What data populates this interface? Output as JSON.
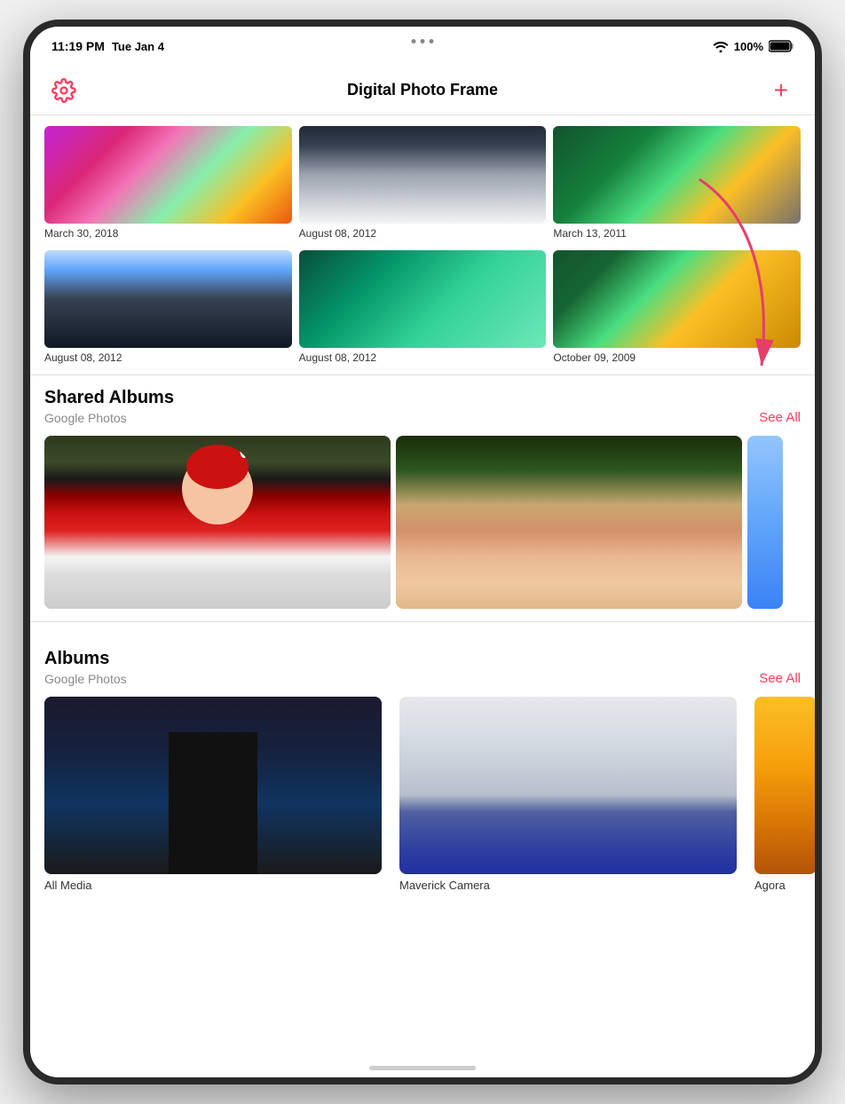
{
  "statusBar": {
    "time": "11:19 PM",
    "date": "Tue Jan 4",
    "battery": "100%",
    "wifi": true
  },
  "header": {
    "title": "Digital Photo Frame",
    "addButton": "+",
    "gearButton": "⚙"
  },
  "photoGrid": {
    "row1": [
      {
        "date": "March 30, 2018",
        "colorClass": "pg1"
      },
      {
        "date": "August 08, 2012",
        "colorClass": "pg2"
      },
      {
        "date": "March 13, 2011",
        "colorClass": "pg3"
      }
    ],
    "row2": [
      {
        "date": "August 08, 2012",
        "colorClass": "pg4"
      },
      {
        "date": "August 08, 2012",
        "colorClass": "pg5"
      },
      {
        "date": "October 09, 2009",
        "colorClass": "pg6"
      }
    ]
  },
  "sharedAlbums": {
    "title": "Shared Albums",
    "subtitle": "Google Photos",
    "seeAll": "See All"
  },
  "albums": {
    "title": "Albums",
    "subtitle": "Google Photos",
    "seeAll": "See All",
    "items": [
      {
        "label": "All Media"
      },
      {
        "label": "Maverick Camera"
      },
      {
        "label": "Agora"
      }
    ]
  },
  "homeIndicator": "",
  "dots": [
    "",
    "",
    ""
  ]
}
